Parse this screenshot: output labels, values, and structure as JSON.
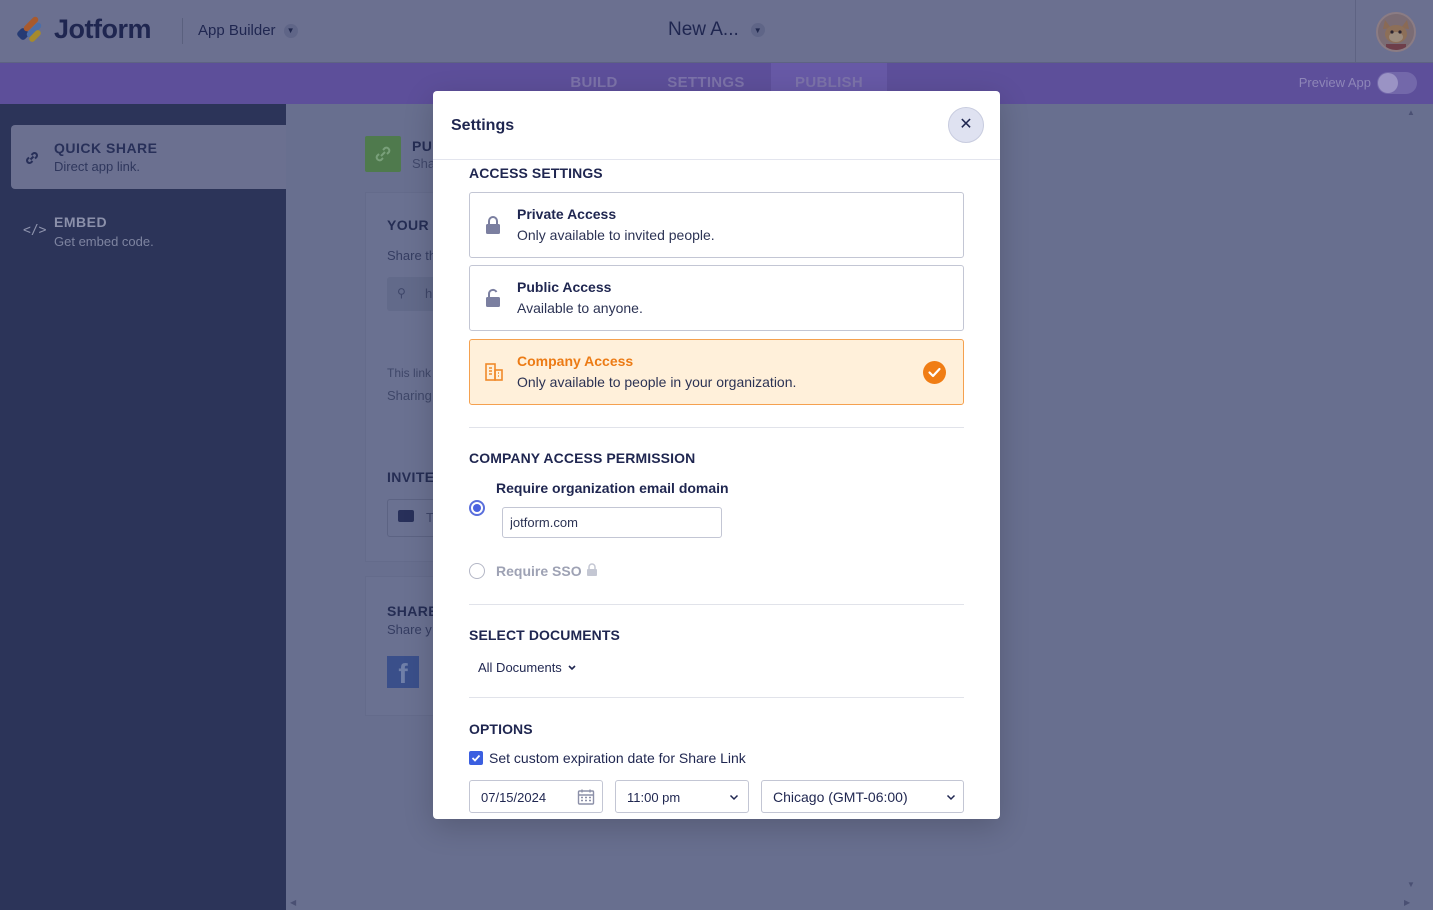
{
  "topbar": {
    "brand": "Jotform",
    "product": "App Builder",
    "app_name": "New A..."
  },
  "nav": {
    "tabs": [
      {
        "label": "BUILD",
        "active": false
      },
      {
        "label": "SETTINGS",
        "active": false
      },
      {
        "label": "PUBLISH",
        "active": true
      }
    ],
    "preview_label": "Preview App"
  },
  "sidebar": {
    "items": [
      {
        "title": "QUICK SHARE",
        "subtitle": "Direct app link.",
        "icon": "link-icon",
        "active": true
      },
      {
        "title": "EMBED",
        "subtitle": "Get embed code.",
        "icon": "code-icon",
        "active": false
      }
    ]
  },
  "background": {
    "publish_title": "PUI",
    "publish_sub": "Sha",
    "your_app": "YOUR A",
    "share_text": "Share th",
    "link_prefix": "h",
    "note1": "This link",
    "note2": "Sharing",
    "invite": "INVITE",
    "invite_prefix": "T",
    "share_title": "SHARE",
    "share_sub": "Share y",
    "facebook_letter": "f"
  },
  "modal": {
    "title": "Settings",
    "access_section": "ACCESS SETTINGS",
    "access_options": [
      {
        "title": "Private Access",
        "subtitle": "Only available to invited people.",
        "icon": "lock-icon",
        "selected": false
      },
      {
        "title": "Public Access",
        "subtitle": "Available to anyone.",
        "icon": "unlock-icon",
        "selected": false
      },
      {
        "title": "Company Access",
        "subtitle": "Only available to people in your organization.",
        "icon": "building-icon",
        "selected": true
      }
    ],
    "permission_section": "COMPANY ACCESS PERMISSION",
    "permission_options": {
      "email_domain_label": "Require organization email domain",
      "email_domain_value": "jotform.com",
      "sso_label": "Require SSO"
    },
    "documents_section": "SELECT DOCUMENTS",
    "documents_select": "All Documents",
    "options_section": "OPTIONS",
    "expiration_label": "Set custom expiration date for Share Link",
    "expiration_checked": true,
    "date_value": "07/15/2024",
    "time_value": "11:00 pm",
    "timezone_value": "Chicago (GMT-06:00)"
  },
  "colors": {
    "accent_orange": "#f07d14",
    "selected_bg": "#fff0da",
    "radio_blue": "#4a62e0",
    "navy": "#1f2650"
  }
}
